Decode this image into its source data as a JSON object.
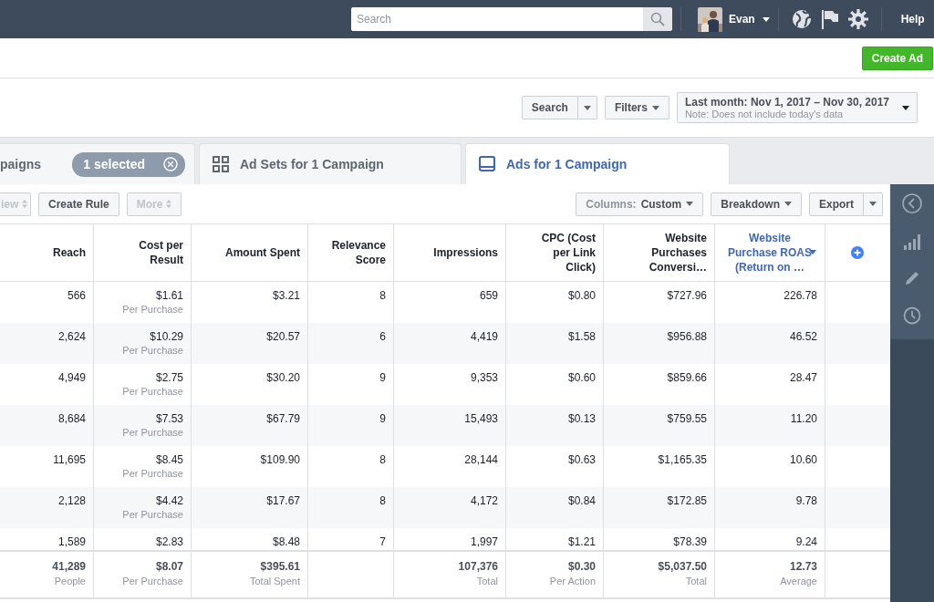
{
  "top_bar": {
    "search": {
      "placeholder": "Search"
    },
    "user": {
      "name": "Evan"
    },
    "help": "Help"
  },
  "create_ad": "Create Ad",
  "filter_bar": {
    "search": "Search",
    "filters": "Filters",
    "date_range": {
      "label": "Last month: Nov 1, 2017 – Nov 30, 2017",
      "note": "Note: Does not include today's data"
    }
  },
  "tabs": [
    {
      "kind": "campaigns",
      "label": "paigns",
      "badge": "1 selected",
      "selected": false
    },
    {
      "kind": "adsets",
      "label": "Ad Sets for 1 Campaign",
      "selected": false
    },
    {
      "kind": "ads",
      "label": "Ads for 1 Campaign",
      "selected": true
    }
  ],
  "toolbar": {
    "left": [
      {
        "label": "iew",
        "disabled": true
      },
      {
        "label": "Create Rule",
        "disabled": false
      },
      {
        "label": "More",
        "disabled": true
      }
    ],
    "columns": {
      "prefix": "Columns:",
      "value": "Custom"
    },
    "breakdown": "Breakdown",
    "export": "Export"
  },
  "table": {
    "columns": [
      {
        "label": "Reach",
        "sorted": false
      },
      {
        "label": "Cost per\nResult",
        "sorted": false
      },
      {
        "label": "Amount Spent",
        "sorted": false
      },
      {
        "label": "Relevance\nScore",
        "sorted": false
      },
      {
        "label": "Impressions",
        "sorted": false
      },
      {
        "label": "CPC (Cost\nper Link\nClick)",
        "sorted": false
      },
      {
        "label": "Website\nPurchases\nConversi…",
        "sorted": false
      },
      {
        "label": "Website\nPurchase ROAS\n(Return on …",
        "sorted": true
      }
    ],
    "rows": [
      {
        "cells": [
          "566",
          "$1.61",
          "$3.21",
          "8",
          "659",
          "$0.80",
          "$727.96",
          "226.78"
        ],
        "sub": "Per Purchase"
      },
      {
        "cells": [
          "2,624",
          "$10.29",
          "$20.57",
          "6",
          "4,419",
          "$1.58",
          "$956.88",
          "46.52"
        ],
        "sub": "Per Purchase"
      },
      {
        "cells": [
          "4,949",
          "$2.75",
          "$30.20",
          "9",
          "9,353",
          "$0.60",
          "$859.66",
          "28.47"
        ],
        "sub": "Per Purchase"
      },
      {
        "cells": [
          "8,684",
          "$7.53",
          "$67.79",
          "9",
          "15,493",
          "$0.13",
          "$759.55",
          "11.20"
        ],
        "sub": "Per Purchase"
      },
      {
        "cells": [
          "11,695",
          "$8.45",
          "$109.90",
          "8",
          "28,144",
          "$0.63",
          "$1,165.35",
          "10.60"
        ],
        "sub": "Per Purchase"
      },
      {
        "cells": [
          "2,128",
          "$4.42",
          "$17.67",
          "8",
          "4,172",
          "$0.84",
          "$172.85",
          "9.78"
        ],
        "sub": "Per Purchase"
      },
      {
        "cells": [
          "1,589",
          "$2.83",
          "$8.48",
          "7",
          "1,997",
          "$1.21",
          "$78.39",
          "9.24"
        ]
      }
    ],
    "totals": [
      {
        "kind": "total",
        "value": "41,289",
        "label": "People"
      },
      {
        "kind": "total",
        "value": "$8.07",
        "label": "Per Purchase"
      },
      {
        "kind": "total",
        "value": "$395.61",
        "label": "Total Spent"
      },
      {
        "kind": "empty"
      },
      {
        "kind": "total",
        "value": "107,376",
        "label": "Total"
      },
      {
        "kind": "total",
        "value": "$0.30",
        "label": "Per Action"
      },
      {
        "kind": "total",
        "value": "$5,037.50",
        "label": "Total"
      },
      {
        "kind": "total",
        "value": "12.73",
        "label": "Average"
      }
    ]
  }
}
